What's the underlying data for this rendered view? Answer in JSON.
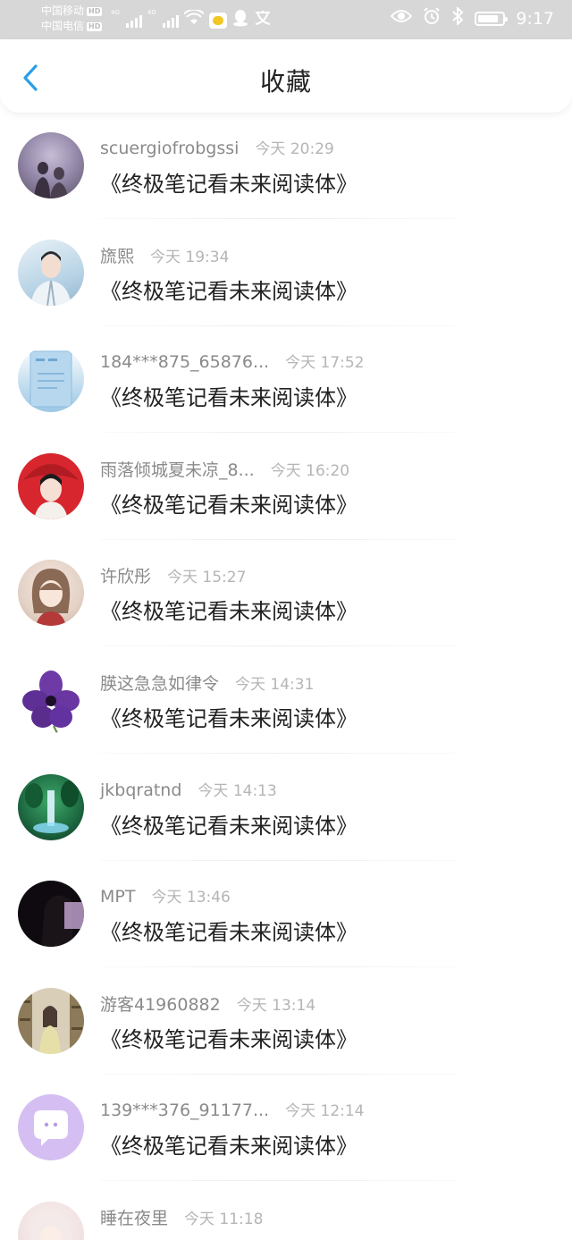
{
  "status_bar": {
    "carrier1": "中国移动",
    "carrier2": "中国电信",
    "hd_badge": "HD",
    "net1": "4G",
    "net2": "4G",
    "time": "9:17",
    "battery_level": 0.85
  },
  "header": {
    "title": "收藏",
    "accent_color": "#2b9fe6"
  },
  "favorites": [
    {
      "user": "scuergiofrobgssi",
      "time": "今天 20:29",
      "content": "《终极笔记看未来阅读体》"
    },
    {
      "user": "旒熙",
      "time": "今天 19:34",
      "content": "《终极笔记看未来阅读体》"
    },
    {
      "user": "184***875_65876...",
      "time": "今天 17:52",
      "content": "《终极笔记看未来阅读体》"
    },
    {
      "user": "雨落倾城夏未凉_8...",
      "time": "今天 16:20",
      "content": "《终极笔记看未来阅读体》"
    },
    {
      "user": "许欣彤",
      "time": "今天 15:27",
      "content": "《终极笔记看未来阅读体》"
    },
    {
      "user": "朠这急急如律令",
      "time": "今天 14:31",
      "content": "《终极笔记看未来阅读体》"
    },
    {
      "user": "jkbqratnd",
      "time": "今天 14:13",
      "content": "《终极笔记看未来阅读体》"
    },
    {
      "user": "MPT",
      "time": "今天 13:46",
      "content": "《终极笔记看未来阅读体》"
    },
    {
      "user": "游客41960882",
      "time": "今天 13:14",
      "content": "《终极笔记看未来阅读体》"
    },
    {
      "user": "139***376_91177...",
      "time": "今天 12:14",
      "content": "《终极笔记看未来阅读体》"
    },
    {
      "user": "睡在夜里",
      "time": "今天 11:18",
      "content": ""
    }
  ]
}
